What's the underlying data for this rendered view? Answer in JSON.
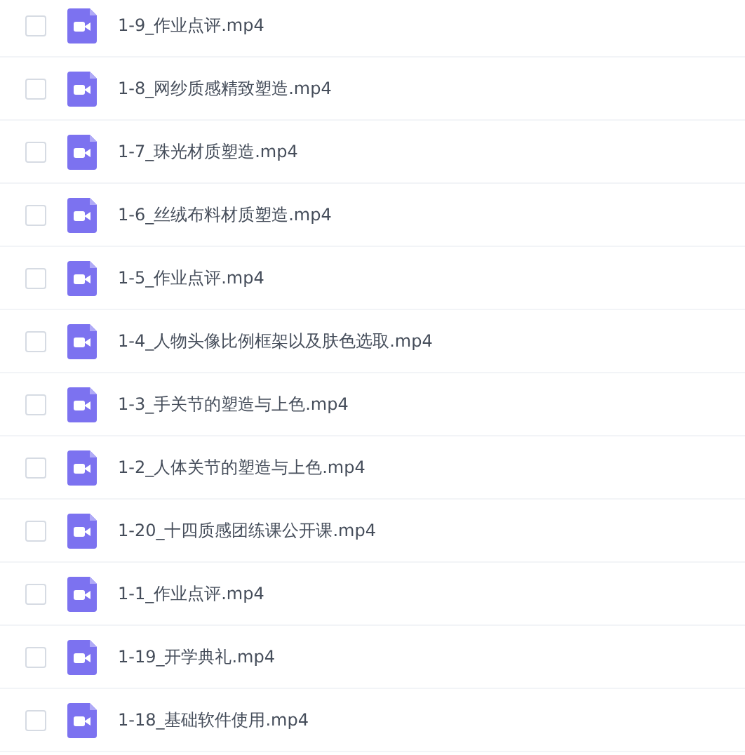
{
  "files": [
    {
      "name": "1-9_作业点评.mp4",
      "checked": false
    },
    {
      "name": "1-8_网纱质感精致塑造.mp4",
      "checked": false
    },
    {
      "name": "1-7_珠光材质塑造.mp4",
      "checked": false
    },
    {
      "name": "1-6_丝绒布料材质塑造.mp4",
      "checked": false
    },
    {
      "name": "1-5_作业点评.mp4",
      "checked": false
    },
    {
      "name": "1-4_人物头像比例框架以及肤色选取.mp4",
      "checked": false
    },
    {
      "name": "1-3_手关节的塑造与上色.mp4",
      "checked": false
    },
    {
      "name": "1-2_人体关节的塑造与上色.mp4",
      "checked": false
    },
    {
      "name": "1-20_十四质感团练课公开课.mp4",
      "checked": false
    },
    {
      "name": "1-1_作业点评.mp4",
      "checked": false
    },
    {
      "name": "1-19_开学典礼.mp4",
      "checked": false
    },
    {
      "name": "1-18_基础软件使用.mp4",
      "checked": false
    }
  ]
}
